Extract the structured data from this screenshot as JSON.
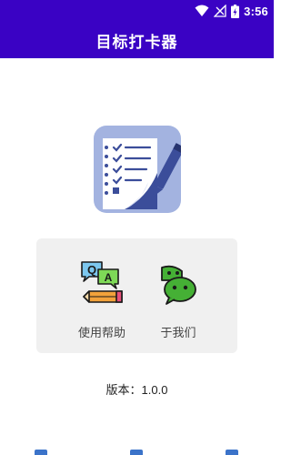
{
  "status_bar": {
    "time": "3:56",
    "icons": [
      "wifi-icon",
      "signal-icon",
      "battery-icon"
    ],
    "color": "#3a02c4"
  },
  "app_bar": {
    "title": "目标打卡器"
  },
  "app_icon": {
    "name": "notebook-pencil-icon"
  },
  "menu": {
    "items": [
      {
        "label": "使用帮助",
        "icon": "qa-chat-pencil-icon"
      },
      {
        "label": "于我们",
        "icon": "wechat-icon"
      }
    ]
  },
  "version": {
    "text": "版本：1.0.0"
  },
  "colors": {
    "primary": "#3a02c4",
    "card_background": "#f0f0f0",
    "icon_background": "#a3b3e0",
    "bottom_marks": "#3b73c9"
  }
}
